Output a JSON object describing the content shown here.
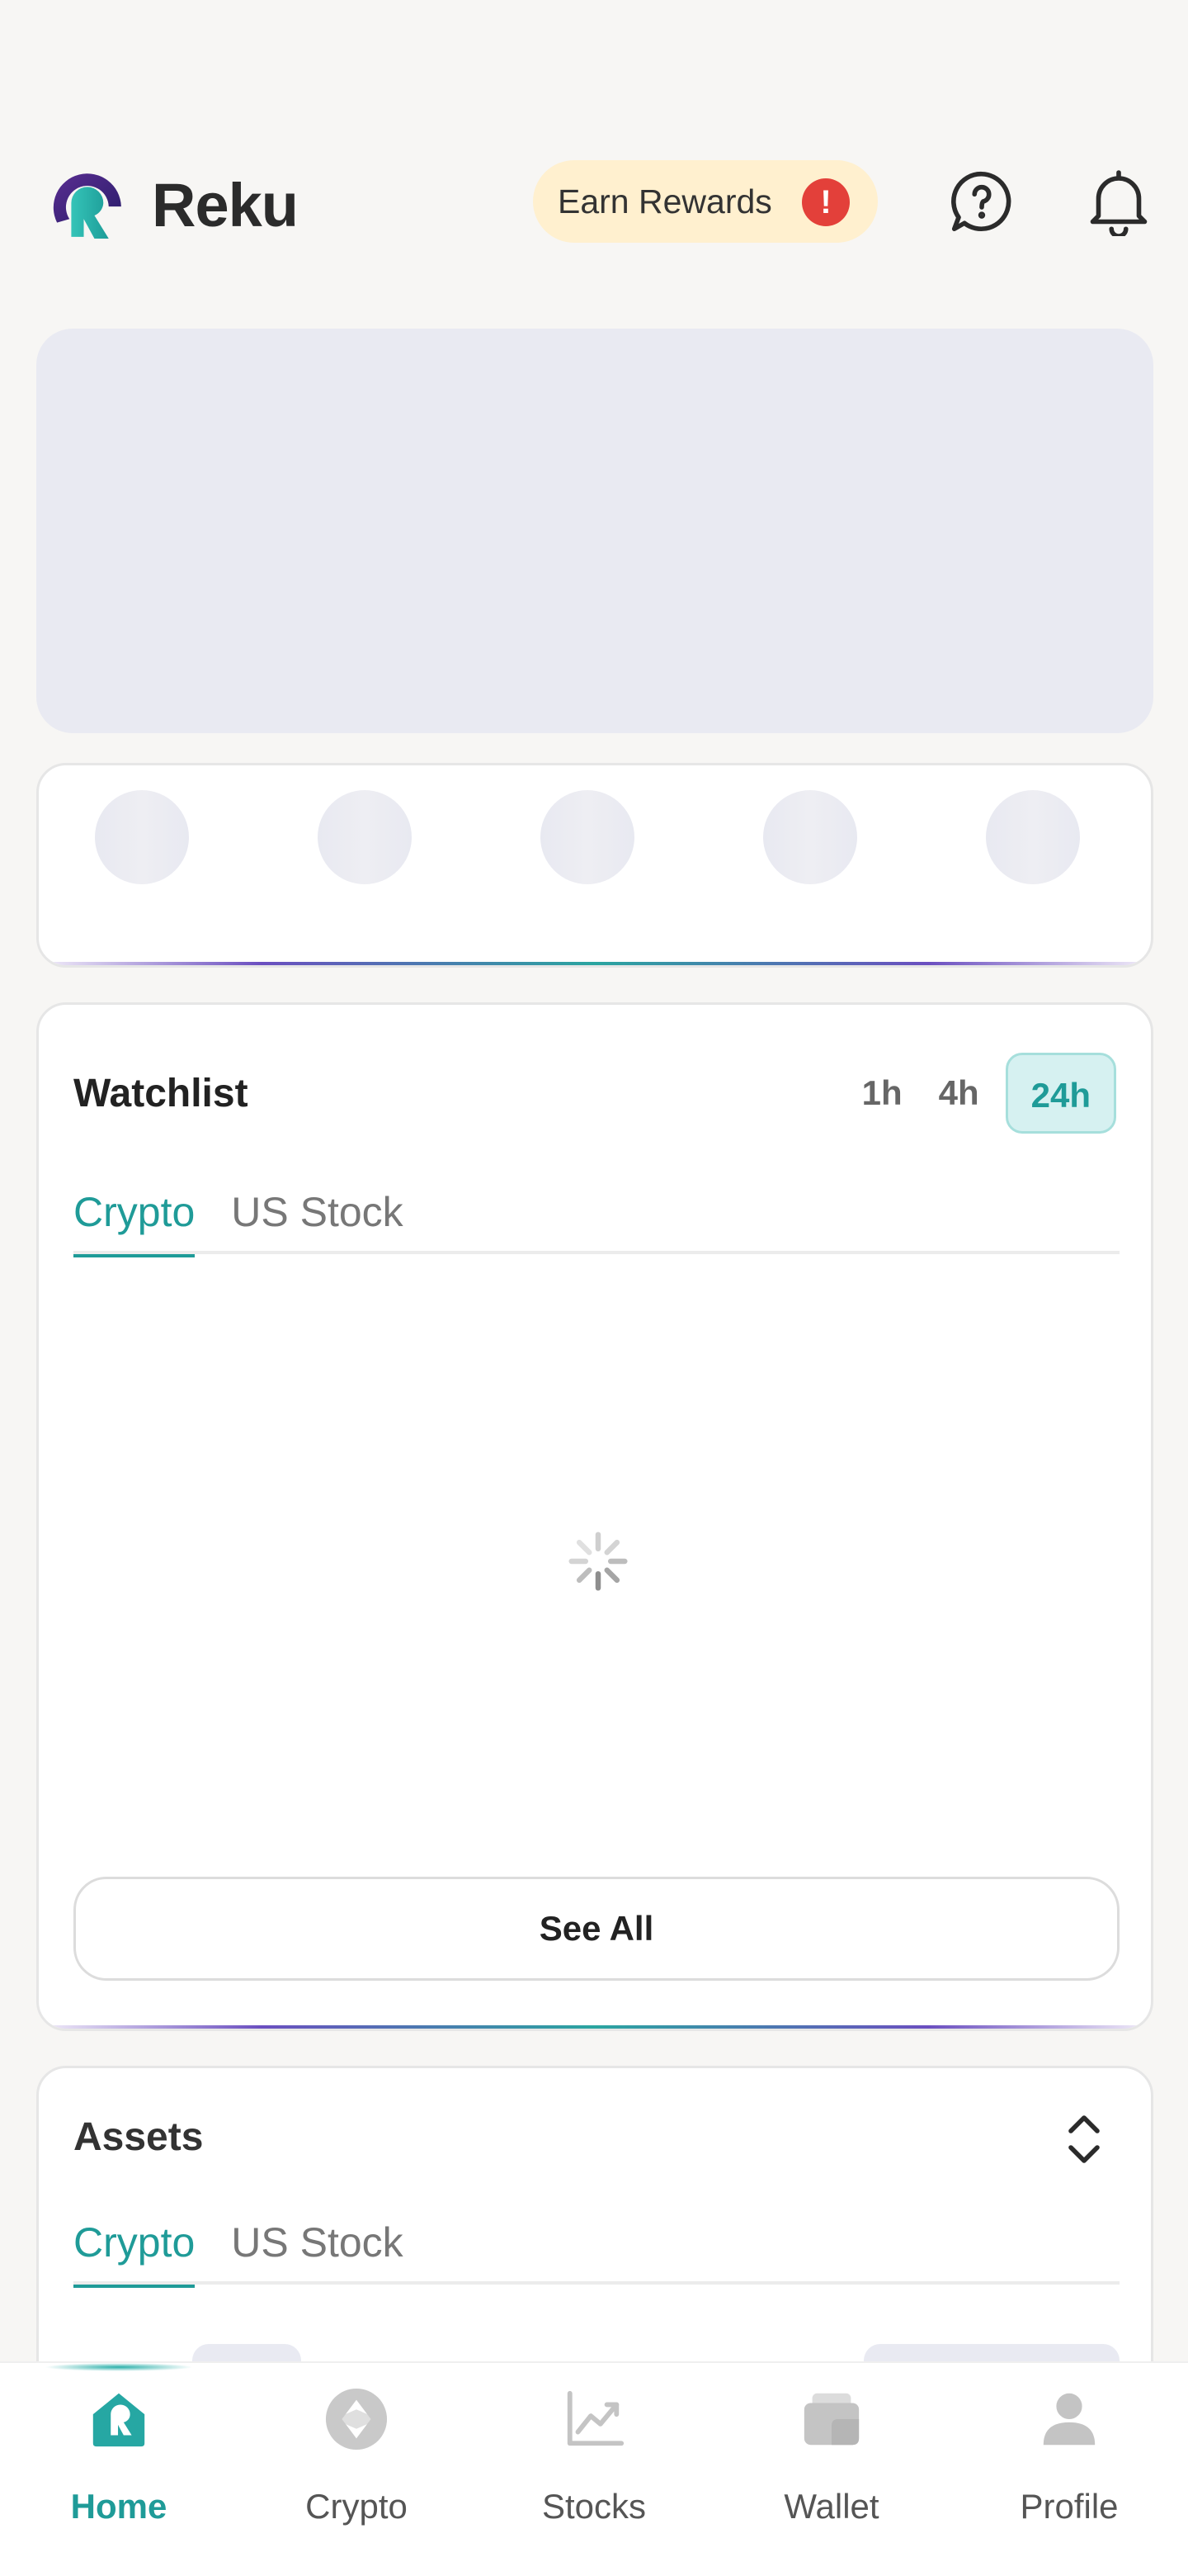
{
  "header": {
    "brand_name": "Reku",
    "earn_rewards_label": "Earn Rewards",
    "earn_alert_glyph": "!",
    "help_icon": "help-chat-icon",
    "notification_icon": "bell-icon"
  },
  "watchlist": {
    "title": "Watchlist",
    "time_filters": [
      "1h",
      "4h",
      "24h"
    ],
    "selected_time_filter": "24h",
    "tabs": [
      "Crypto",
      "US Stock"
    ],
    "active_tab": "Crypto",
    "loading": true,
    "see_all_label": "See All"
  },
  "assets": {
    "title": "Assets",
    "tabs": [
      "Crypto",
      "US Stock"
    ],
    "active_tab": "Crypto"
  },
  "bottom_nav": {
    "items": [
      {
        "label": "Home",
        "icon": "home-icon",
        "active": true
      },
      {
        "label": "Crypto",
        "icon": "crypto-icon",
        "active": false
      },
      {
        "label": "Stocks",
        "icon": "stocks-chart-icon",
        "active": false
      },
      {
        "label": "Wallet",
        "icon": "wallet-icon",
        "active": false
      },
      {
        "label": "Profile",
        "icon": "profile-icon",
        "active": false
      }
    ]
  },
  "colors": {
    "accent": "#1f9b98",
    "brand_purple": "#4b2a8c",
    "earn_bg": "#fff0cf",
    "alert_red": "#e3403a",
    "skeleton": "#e9eaf2"
  }
}
